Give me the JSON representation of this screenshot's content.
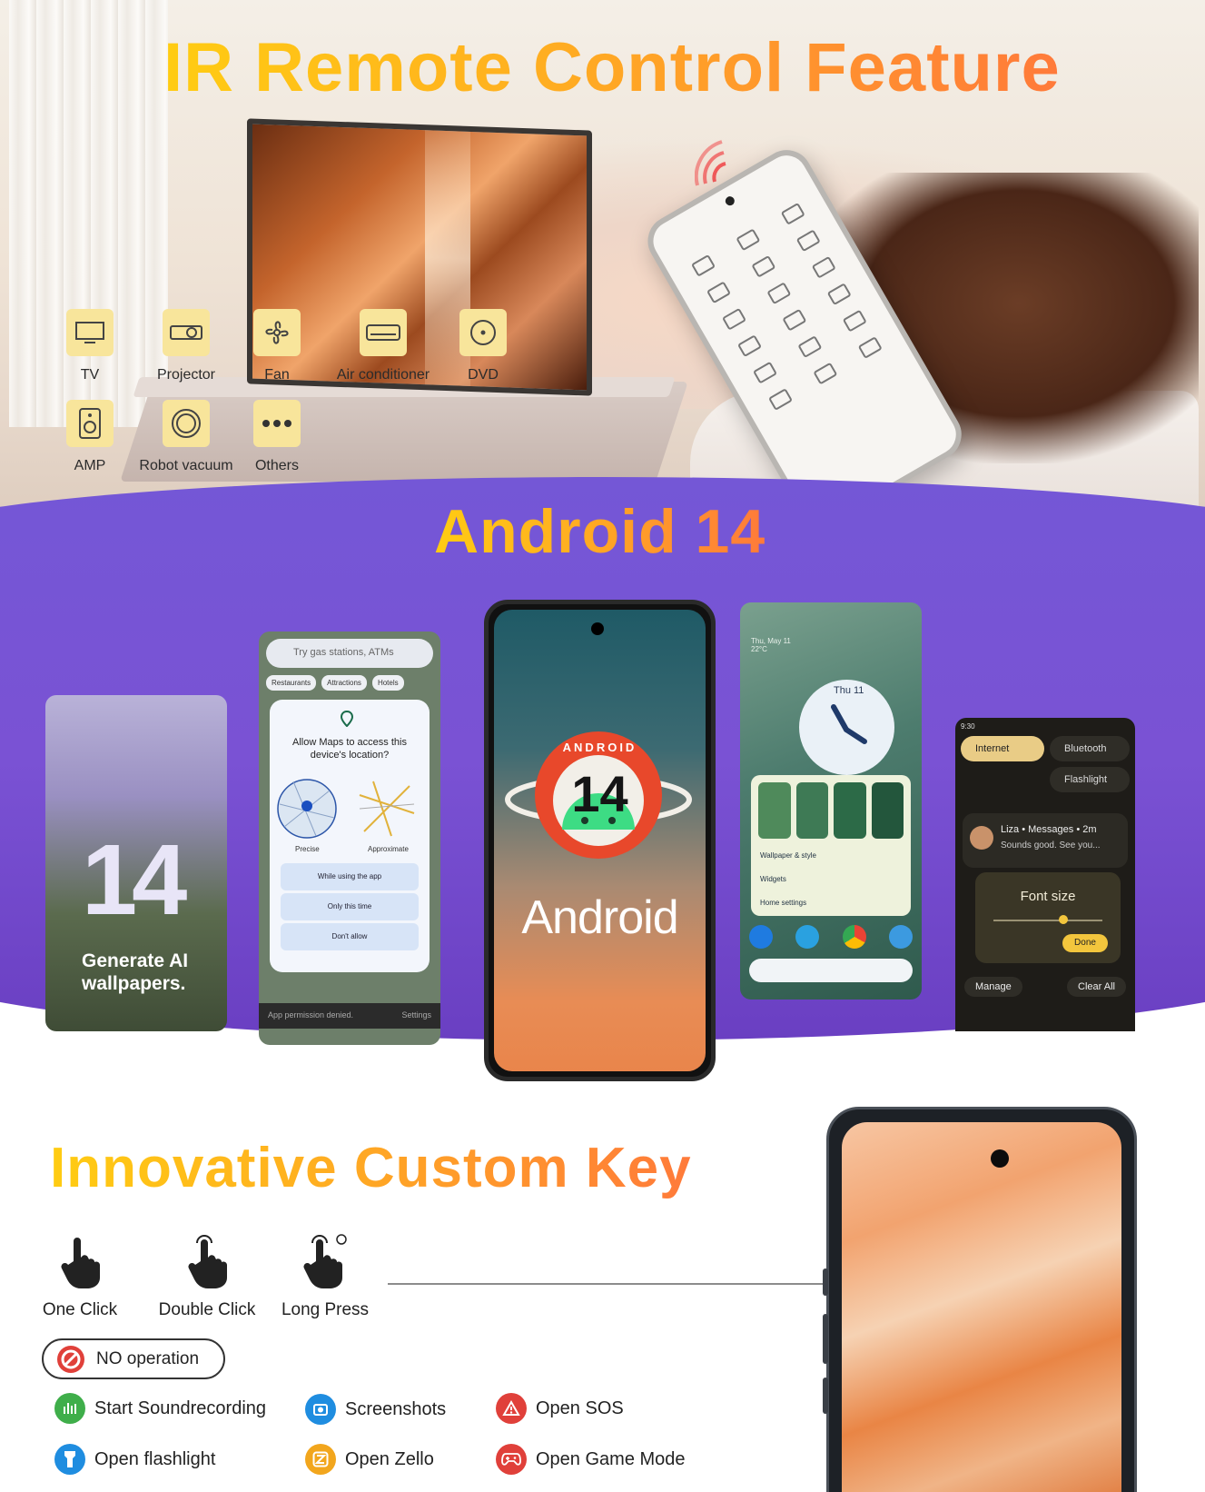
{
  "ir": {
    "title": "IR Remote Control Feature",
    "devices": [
      "TV",
      "Projector",
      "Fan",
      "Air conditioner",
      "DVD",
      "AMP",
      "Robot vacuum",
      "Others"
    ]
  },
  "android": {
    "title": "Android 14",
    "wallpaper": {
      "number": "14",
      "caption": "Generate AI wallpapers."
    },
    "maps": {
      "search_placeholder": "Try gas stations, ATMs",
      "chips": [
        "Restaurants",
        "Attractions",
        "Hotels"
      ],
      "prompt": "Allow Maps to access this device's location?",
      "precise": "Precise",
      "approximate": "Approximate",
      "options": [
        "While using the app",
        "Only this time",
        "Don't allow"
      ],
      "snackbar": "App permission denied.",
      "snackbar_action": "Settings"
    },
    "center": {
      "badge_text": "ANDROID",
      "version": "14",
      "word": "Android"
    },
    "home": {
      "date": "Thu, May 11",
      "temp": "22°C",
      "clock_label": "Thu 11",
      "menu": [
        "Wallpaper & style",
        "Widgets",
        "Home settings"
      ]
    },
    "quick": {
      "time": "9:30",
      "tiles": [
        "Internet",
        "Bluetooth",
        "Flashlight"
      ],
      "notif_title": "Liza • Messages • 2m",
      "notif_body": "Sounds good. See you...",
      "font_size": "Font size",
      "done": "Done",
      "manage": "Manage",
      "clear_all": "Clear All"
    }
  },
  "custom_key": {
    "title": "Innovative Custom Key",
    "gestures": [
      "One Click",
      "Double Click",
      "Long Press"
    ],
    "no_operation": "NO operation",
    "actions": [
      {
        "label": "Start Soundrecording",
        "color": "#3fae4a"
      },
      {
        "label": "Screenshots",
        "color": "#1f8de0"
      },
      {
        "label": "Open SOS",
        "color": "#e0403a"
      },
      {
        "label": "Open flashlight",
        "color": "#1f8de0"
      },
      {
        "label": "Open Zello",
        "color": "#f2a61d"
      },
      {
        "label": "Open Game Mode",
        "color": "#e0403a"
      }
    ]
  }
}
